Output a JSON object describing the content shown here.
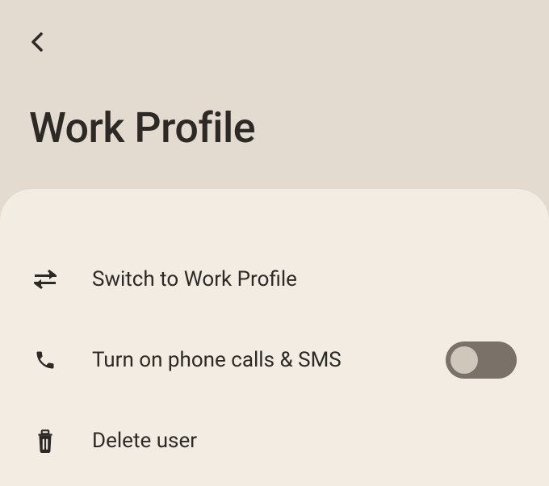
{
  "header": {
    "title": "Work Profile"
  },
  "items": {
    "switch": {
      "label": "Switch to Work Profile"
    },
    "phone": {
      "label": "Turn on phone calls & SMS",
      "toggle_on": false
    },
    "delete": {
      "label": "Delete user"
    }
  }
}
